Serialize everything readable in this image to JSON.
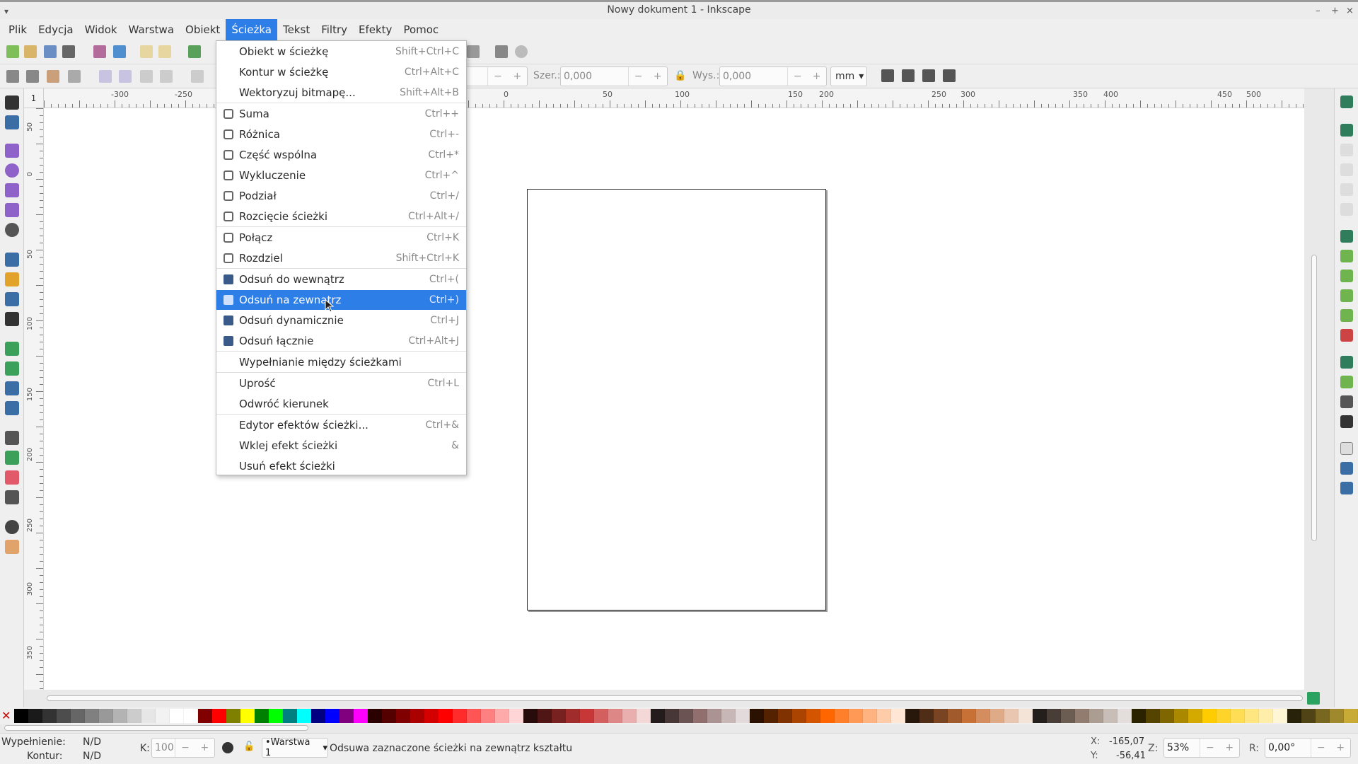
{
  "window": {
    "title": "Nowy dokument 1 - Inkscape",
    "controls": [
      "–",
      "+",
      "×"
    ],
    "menu_glyph": "▾"
  },
  "menubar": [
    "Plik",
    "Edycja",
    "Widok",
    "Warstwa",
    "Obiekt",
    "Ścieżka",
    "Tekst",
    "Filtry",
    "Efekty",
    "Pomoc"
  ],
  "active_menu": "Ścieżka",
  "toolbar": {
    "x_value": "",
    "w_label": "Szer.:",
    "w_value": "0,000",
    "h_label": "Wys.:",
    "h_value": "0,000",
    "unit": "mm"
  },
  "ruler_corner": "1",
  "ruler_h_ticks": [
    "-300",
    "-250",
    "0",
    "50",
    "100",
    "150",
    "200",
    "250",
    "300",
    "350",
    "400",
    "450",
    "500"
  ],
  "ruler_v_ticks": [
    "50",
    "0",
    "50",
    "100",
    "150",
    "200",
    "250",
    "300",
    "350"
  ],
  "menu": {
    "items": [
      {
        "label": "Obiekt w ścieżkę",
        "shortcut": "Shift+Ctrl+C",
        "icon": ""
      },
      {
        "label": "Kontur w ścieżkę",
        "shortcut": "Ctrl+Alt+C",
        "icon": ""
      },
      {
        "label": "Wektoryzuj bitmapę...",
        "shortcut": "Shift+Alt+B",
        "icon": ""
      },
      {
        "label": "Suma",
        "shortcut": "Ctrl++",
        "icon": "union-icon"
      },
      {
        "label": "Różnica",
        "shortcut": "Ctrl+-",
        "icon": "difference-icon"
      },
      {
        "label": "Część wspólna",
        "shortcut": "Ctrl+*",
        "icon": "intersection-icon"
      },
      {
        "label": "Wykluczenie",
        "shortcut": "Ctrl+^",
        "icon": "exclusion-icon"
      },
      {
        "label": "Podział",
        "shortcut": "Ctrl+/",
        "icon": "division-icon"
      },
      {
        "label": "Rozcięcie ścieżki",
        "shortcut": "Ctrl+Alt+/",
        "icon": "cut-path-icon"
      },
      {
        "label": "Połącz",
        "shortcut": "Ctrl+K",
        "icon": "combine-icon"
      },
      {
        "label": "Rozdziel",
        "shortcut": "Shift+Ctrl+K",
        "icon": "break-apart-icon"
      },
      {
        "label": "Odsuń do wewnątrz",
        "shortcut": "Ctrl+(",
        "icon": "inset-icon"
      },
      {
        "label": "Odsuń na zewnątrz",
        "shortcut": "Ctrl+)",
        "icon": "outset-icon"
      },
      {
        "label": "Odsuń dynamicznie",
        "shortcut": "Ctrl+J",
        "icon": "dynamic-offset-icon"
      },
      {
        "label": "Odsuń łącznie",
        "shortcut": "Ctrl+Alt+J",
        "icon": "linked-offset-icon"
      },
      {
        "label": "Wypełnianie między ścieżkami",
        "shortcut": "",
        "icon": ""
      },
      {
        "label": "Uprość",
        "shortcut": "Ctrl+L",
        "icon": ""
      },
      {
        "label": "Odwróć kierunek",
        "shortcut": "",
        "icon": ""
      },
      {
        "label": "Edytor efektów ścieżki...",
        "shortcut": "Ctrl+&",
        "icon": ""
      },
      {
        "label": "Wklej efekt ścieżki",
        "shortcut": "&",
        "icon": ""
      },
      {
        "label": "Usuń efekt ścieżki",
        "shortcut": "",
        "icon": ""
      }
    ],
    "highlighted_index": 12,
    "separators_after": [
      2,
      8,
      10,
      14,
      15,
      17
    ]
  },
  "palette": [
    "#000000",
    "#1a1a1a",
    "#333333",
    "#4d4d4d",
    "#666666",
    "#808080",
    "#999999",
    "#b3b3b3",
    "#cccccc",
    "#e6e6e6",
    "#f2f2f2",
    "#ffffff",
    "#ffffff",
    "#800000",
    "#ff0000",
    "#808000",
    "#ffff00",
    "#008000",
    "#00ff00",
    "#008080",
    "#00ffff",
    "#000080",
    "#0000ff",
    "#800080",
    "#ff00ff",
    "#2b0000",
    "#550000",
    "#800000",
    "#aa0000",
    "#d40000",
    "#ff0000",
    "#ff2a2a",
    "#ff5555",
    "#ff8080",
    "#ffaaaa",
    "#ffd5d5",
    "#280b0b",
    "#501616",
    "#782121",
    "#a02c2c",
    "#c83737",
    "#d35f5f",
    "#de8787",
    "#e9afaf",
    "#f4d7d7",
    "#241c1c",
    "#483737",
    "#6c5353",
    "#916f6f",
    "#ac9393",
    "#c8b7b7",
    "#e3dbdb",
    "#2b1100",
    "#552200",
    "#803300",
    "#aa4400",
    "#d45500",
    "#ff6600",
    "#ff7f2a",
    "#ff9955",
    "#ffb380",
    "#ffccaa",
    "#ffe6d5",
    "#28170b",
    "#502d16",
    "#784421",
    "#a05a2c",
    "#c87137",
    "#d38d5f",
    "#deaa87",
    "#e9c6af",
    "#f4e3d7",
    "#241f1c",
    "#483e37",
    "#6c5d53",
    "#917c6f",
    "#ac9d93",
    "#c8beb7",
    "#e3dedb",
    "#2b2200",
    "#554400",
    "#806600",
    "#aa8800",
    "#d4aa00",
    "#ffcc00",
    "#ffd42a",
    "#ffdd55",
    "#ffe680",
    "#ffeeaa",
    "#fff6d5",
    "#28220b",
    "#504416",
    "#786721",
    "#a0892c",
    "#c8ab37",
    "#d3bc5f"
  ],
  "status": {
    "fill_label": "Wypełnienie:",
    "fill_value": "N/D",
    "stroke_label": "Kontur:",
    "stroke_value": "N/D",
    "opacity_label": "K:",
    "opacity_value": "100",
    "layer": "•Warstwa 1",
    "message": "Odsuwa zaznaczone ścieżki na zewnątrz kształtu",
    "x_label": "X:",
    "x_value": "-165,07",
    "y_label": "Y:",
    "y_value": "-56,41",
    "zoom_label": "Z:",
    "zoom_value": "53%",
    "rotation_label": "R:",
    "rotation_value": "0,00°"
  },
  "colors": {
    "accent": "#2d7ee6",
    "canvas": "#ffffff"
  }
}
